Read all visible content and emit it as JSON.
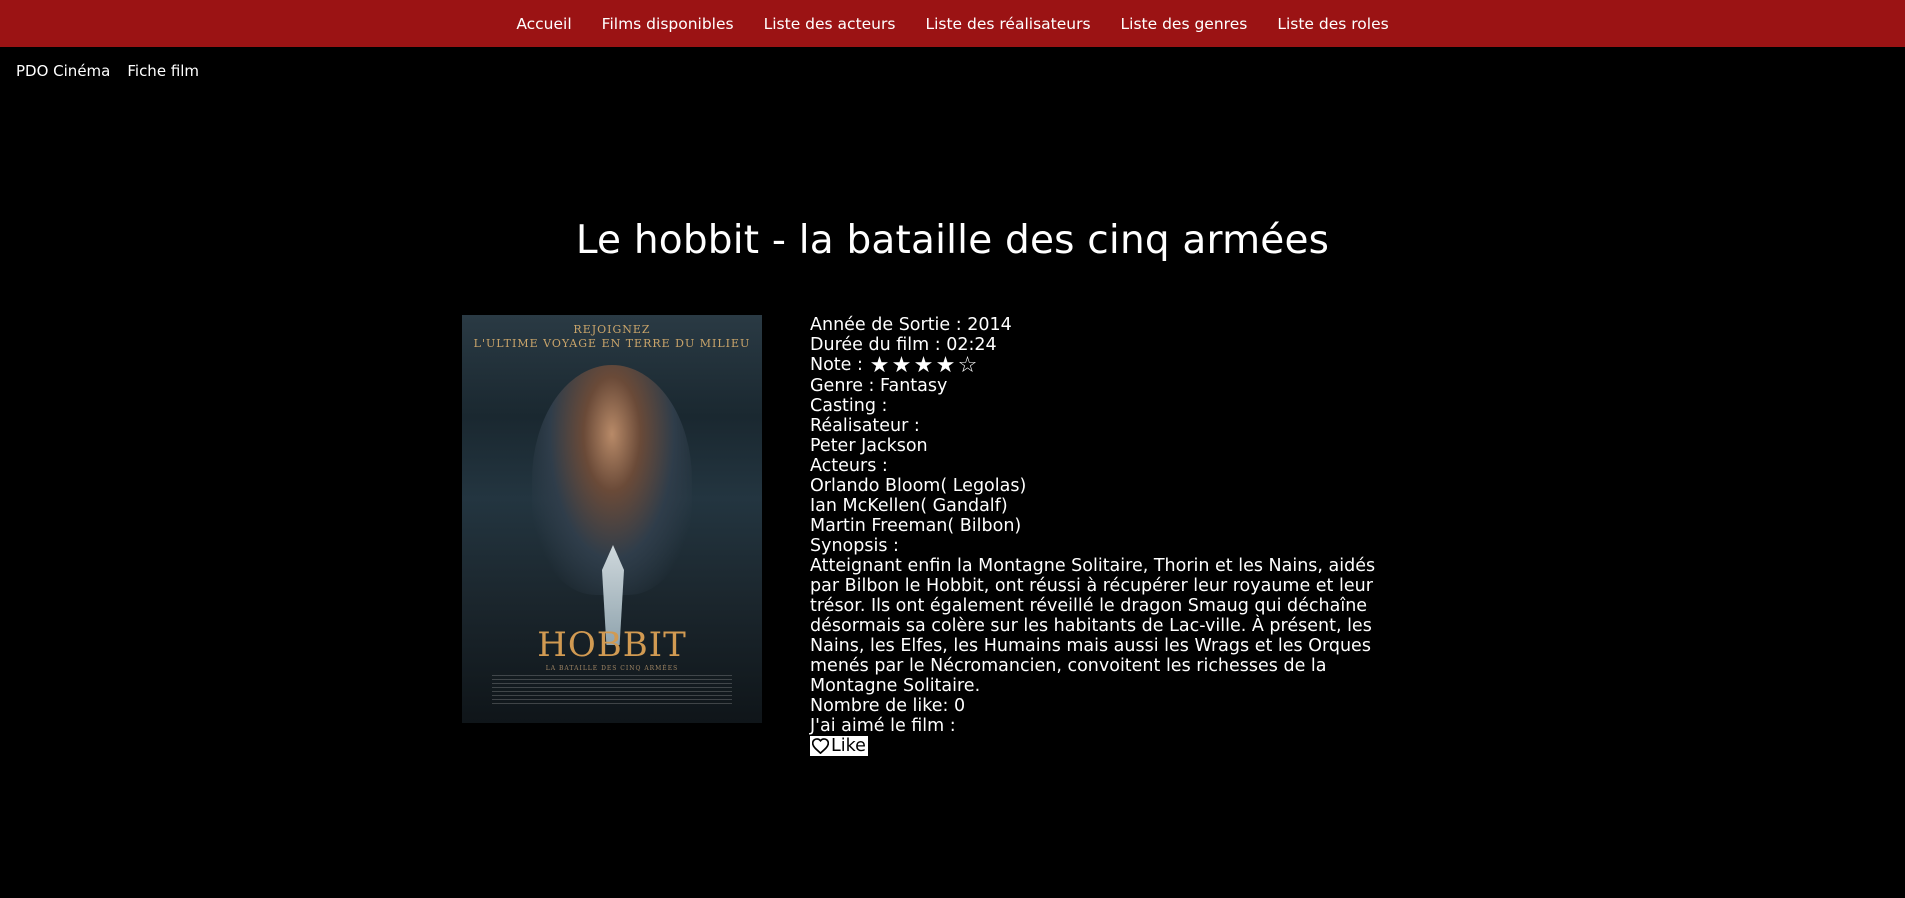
{
  "nav": {
    "items": [
      {
        "label": "Accueil"
      },
      {
        "label": "Films disponibles"
      },
      {
        "label": "Liste des acteurs"
      },
      {
        "label": "Liste des réalisateurs"
      },
      {
        "label": "Liste des genres"
      },
      {
        "label": "Liste des roles"
      }
    ],
    "background": "#9b1314"
  },
  "breadcrumb": {
    "brand": "PDO Cinéma",
    "page": "Fiche film"
  },
  "film": {
    "title": "Le hobbit - la bataille des cinq armées",
    "poster": {
      "tagline_top": "REJOIGNEZ",
      "tagline": "L'ULTIME VOYAGE EN TERRE DU MILIEU",
      "logo": "HOBBIT",
      "subtitle": "LA BATAILLE DES CINQ ARMÉES"
    },
    "year_label": "Année de Sortie : 2014",
    "duration_label": "Durée du film : 02:24",
    "rating_label": "Note : ",
    "rating": 4,
    "rating_max": 5,
    "genre_label": "Genre : Fantasy",
    "casting_label": "Casting :",
    "director_heading": "Réalisateur :",
    "director": "Peter Jackson",
    "actors_heading": "Acteurs :",
    "actors": [
      "Orlando Bloom( Legolas)",
      "Ian McKellen( Gandalf)",
      "Martin Freeman( Bilbon)"
    ],
    "synopsis_heading": "Synopsis :",
    "synopsis": "Atteignant enfin la Montagne Solitaire, Thorin et les Nains, aidés par Bilbon le Hobbit, ont réussi à récupérer leur royaume et leur trésor. Ils ont également réveillé le dragon Smaug qui déchaîne désormais sa colère sur les habitants de Lac-ville. À présent, les Nains, les Elfes, les Humains mais aussi les Wrags et les Orques menés par le Nécromancien, convoitent les richesses de la Montagne Solitaire.",
    "likes_label": "Nombre de like: 0",
    "liked_label": "J'ai aimé le film :",
    "like_button": "Like"
  }
}
